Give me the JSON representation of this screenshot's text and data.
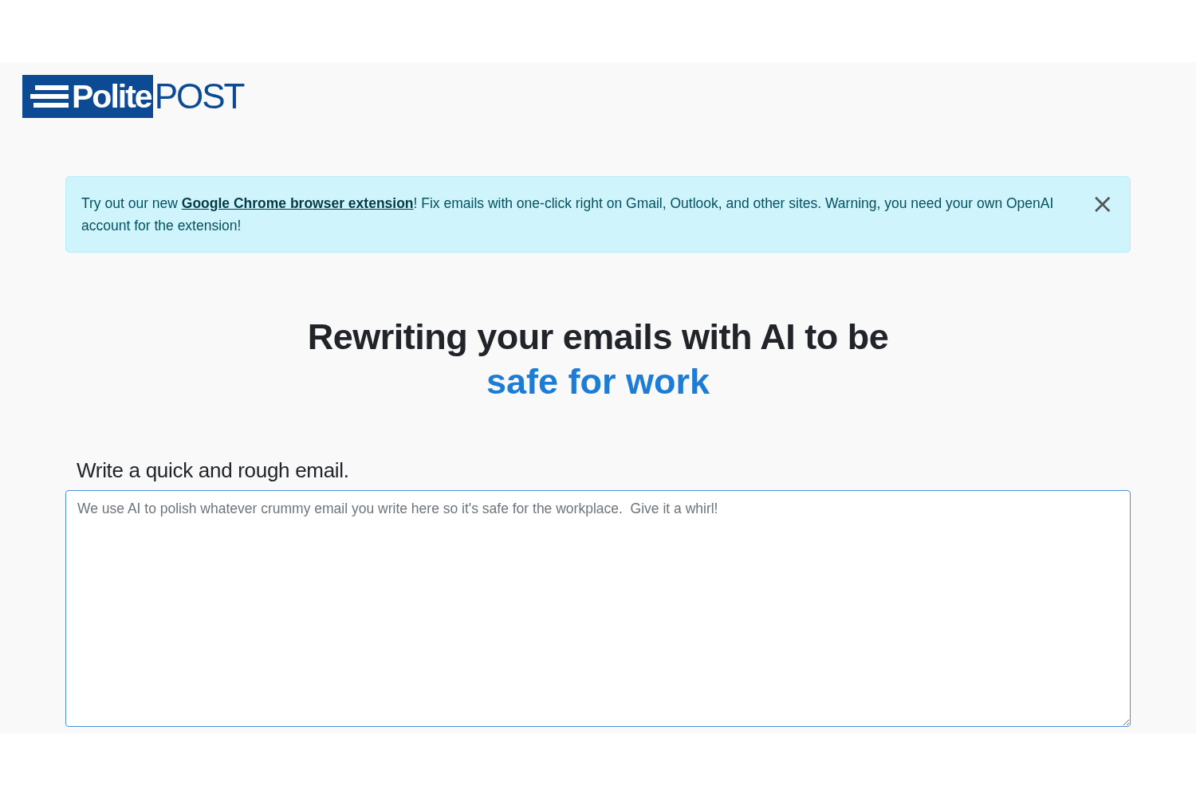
{
  "logo": {
    "boxed_text": "Polite",
    "text": "POST"
  },
  "alert": {
    "before": "Try out our new ",
    "link": "Google Chrome browser extension",
    "after": "! Fix emails with one-click right on Gmail, Outlook, and other sites. Warning, you need your own OpenAI account for the extension!",
    "close": "×"
  },
  "heading": {
    "line1": "Rewriting your emails with AI to be",
    "line2": "safe for work"
  },
  "email_field": {
    "label": "Write a quick and rough email.",
    "placeholder": "We use AI to polish whatever crummy email you write here so it's safe for the workplace.  Give it a whirl!"
  }
}
